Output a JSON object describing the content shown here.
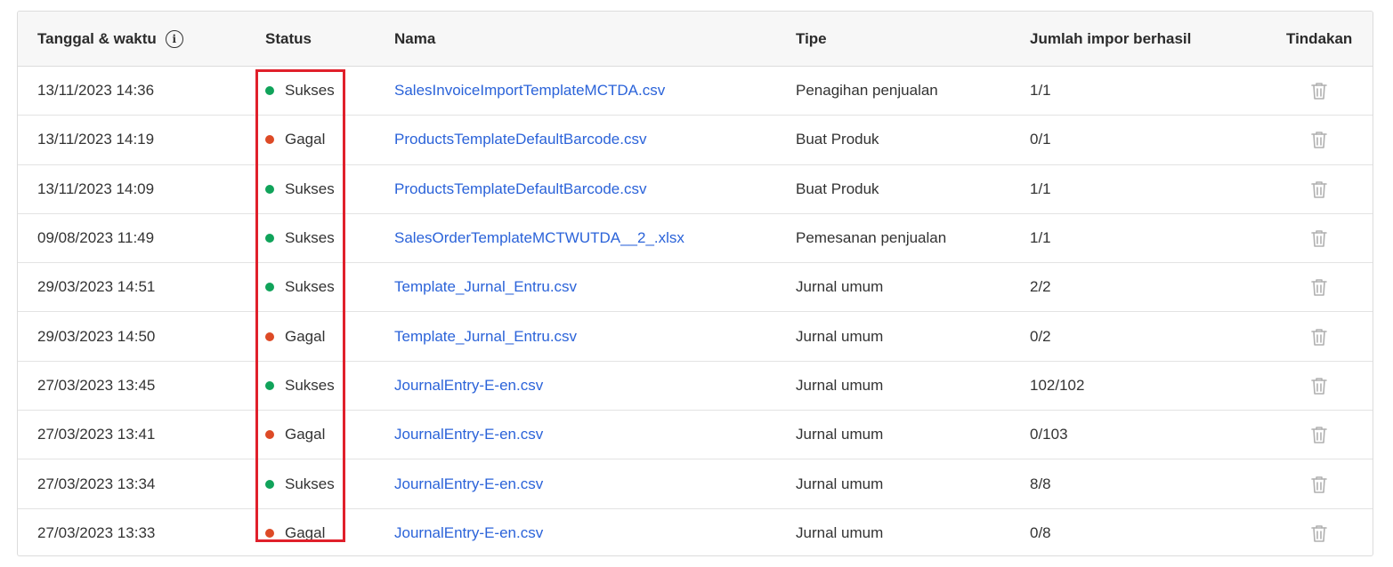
{
  "colors": {
    "success": "#10a35a",
    "fail": "#dd4a26",
    "link": "#2b63d9",
    "icon": "#b0b0b0",
    "highlight": "#e0202b"
  },
  "header": {
    "datetime": "Tanggal & waktu",
    "info_icon": "info-icon",
    "status": "Status",
    "name": "Nama",
    "type": "Tipe",
    "count": "Jumlah impor berhasil",
    "action": "Tindakan"
  },
  "rows": [
    {
      "datetime": "13/11/2023 14:36",
      "status": "Sukses",
      "status_kind": "success",
      "name": "SalesInvoiceImportTemplateMCTDA.csv",
      "type": "Penagihan penjualan",
      "count": "1/1",
      "action_icon": "trash-icon"
    },
    {
      "datetime": "13/11/2023 14:19",
      "status": "Gagal",
      "status_kind": "fail",
      "name": "ProductsTemplateDefaultBarcode.csv",
      "type": "Buat Produk",
      "count": "0/1",
      "action_icon": "trash-icon"
    },
    {
      "datetime": "13/11/2023 14:09",
      "status": "Sukses",
      "status_kind": "success",
      "name": "ProductsTemplateDefaultBarcode.csv",
      "type": "Buat Produk",
      "count": "1/1",
      "action_icon": "trash-icon"
    },
    {
      "datetime": "09/08/2023 11:49",
      "status": "Sukses",
      "status_kind": "success",
      "name": "SalesOrderTemplateMCTWUTDA__2_.xlsx",
      "type": "Pemesanan penjualan",
      "count": "1/1",
      "action_icon": "trash-icon"
    },
    {
      "datetime": "29/03/2023 14:51",
      "status": "Sukses",
      "status_kind": "success",
      "name": "Template_Jurnal_Entru.csv",
      "type": "Jurnal umum",
      "count": "2/2",
      "action_icon": "trash-icon"
    },
    {
      "datetime": "29/03/2023 14:50",
      "status": "Gagal",
      "status_kind": "fail",
      "name": "Template_Jurnal_Entru.csv",
      "type": "Jurnal umum",
      "count": "0/2",
      "action_icon": "trash-icon"
    },
    {
      "datetime": "27/03/2023 13:45",
      "status": "Sukses",
      "status_kind": "success",
      "name": "JournalEntry-E-en.csv",
      "type": "Jurnal umum",
      "count": "102/102",
      "action_icon": "trash-icon"
    },
    {
      "datetime": "27/03/2023 13:41",
      "status": "Gagal",
      "status_kind": "fail",
      "name": "JournalEntry-E-en.csv",
      "type": "Jurnal umum",
      "count": "0/103",
      "action_icon": "trash-icon"
    },
    {
      "datetime": "27/03/2023 13:34",
      "status": "Sukses",
      "status_kind": "success",
      "name": "JournalEntry-E-en.csv",
      "type": "Jurnal umum",
      "count": "8/8",
      "action_icon": "trash-icon"
    },
    {
      "datetime": "27/03/2023 13:33",
      "status": "Gagal",
      "status_kind": "fail",
      "name": "JournalEntry-E-en.csv",
      "type": "Jurnal umum",
      "count": "0/8",
      "action_icon": "trash-icon"
    }
  ]
}
